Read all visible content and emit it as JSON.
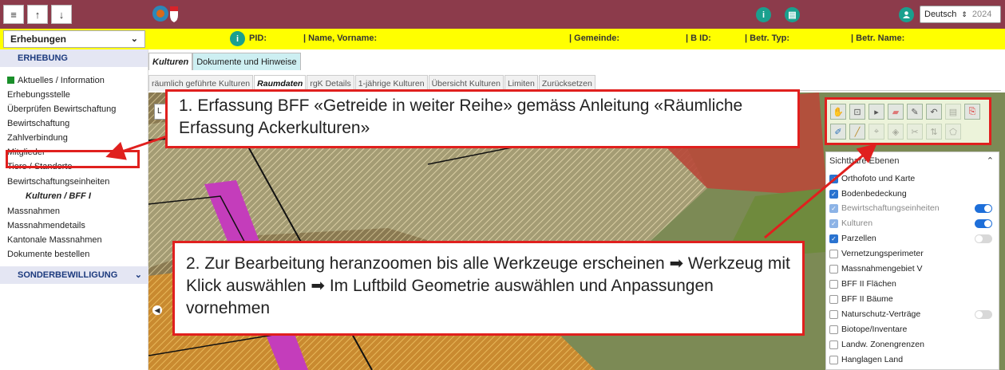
{
  "topbar": {
    "menu_icon": "hamburger-icon",
    "up_icon": "arrow-up-icon",
    "down_icon": "arrow-down-icon",
    "info_label": "i",
    "doc_label": "▤",
    "user_label": "●",
    "language": "Deutsch",
    "year": "2024"
  },
  "header": {
    "survey_select": "Erhebungen",
    "info_label": "i",
    "columns": [
      "PID:",
      "| Name, Vorname:",
      "| Gemeinde:",
      "| B ID:",
      "| Betr. Typ:",
      "| Betr. Name:"
    ]
  },
  "sidebar": {
    "section1": "ERHEBUNG",
    "items": [
      "Aktuelles / Information",
      "Erhebungsstelle",
      "Überprüfen Bewirtschaftung",
      "Bewirtschaftung",
      "Zahlverbindung",
      "Mitglieder",
      "Tiere / Standorte",
      "Bewirtschaftungseinheiten",
      "Kulturen / BFF I",
      "Massnahmen",
      "Massnahmendetails",
      "Kantonale Massnahmen",
      "Dokumente bestellen"
    ],
    "section2": "SONDERBEWILLIGUNG"
  },
  "tabs": {
    "primary": [
      "Kulturen",
      "Dokumente und Hinweise"
    ],
    "secondary": [
      "räumlich geführte Kulturen",
      "Raumdaten",
      "rgK Details",
      "1-jährige Kulturen",
      "Übersicht Kulturen",
      "Limiten",
      "Zurücksetzen"
    ]
  },
  "map": {
    "layer_panel_title": "Sichtbare Ebenen",
    "layers": [
      {
        "label": "Orthofoto und Karte",
        "checked": true
      },
      {
        "label": "Bodenbedeckung",
        "checked": true
      },
      {
        "label": "Bewirtschaftungseinheiten",
        "checked": true,
        "toggle": "on"
      },
      {
        "label": "Kulturen",
        "checked": true,
        "toggle": "on"
      },
      {
        "label": "Parzellen",
        "checked": true,
        "toggle": "off"
      },
      {
        "label": "Vernetzungsperimeter",
        "checked": false
      },
      {
        "label": "Massnahmengebiet V",
        "checked": false
      },
      {
        "label": "BFF II Flächen",
        "checked": false
      },
      {
        "label": "BFF II Bäume",
        "checked": false
      },
      {
        "label": "Naturschutz-Verträge",
        "checked": false,
        "toggle": "off"
      },
      {
        "label": "Biotope/Inventare",
        "checked": false
      },
      {
        "label": "Landw. Zonengrenzen",
        "checked": false
      },
      {
        "label": "Hanglagen Land",
        "checked": false
      }
    ],
    "tools_row1": [
      "hand-icon",
      "zoom-box-icon",
      "pointer-icon",
      "eraser-icon",
      "pencil-icon",
      "undo-icon",
      "document-icon",
      "pdf-icon"
    ],
    "tools_row2": [
      "edit-vertex-icon",
      "draw-line-icon",
      "split-icon",
      "merge-icon",
      "cut-icon",
      "measure-icon",
      "polygon-icon"
    ]
  },
  "callouts": {
    "callout1": "1. Erfassung BFF «Getreide in weiter Reihe» gemäss Anleitung «Räumliche Erfassung Ackerkulturen»",
    "callout2": "2. Zur Bearbeitung heranzoomen bis alle Werkzeuge erscheinen ➡ Werkzeug mit Klick auswählen ➡ Im Luftbild Geometrie auswählen und Anpassungen vornehmen"
  },
  "colors": {
    "topbar": "#8c3b4b",
    "header": "#ffff00",
    "accent": "#1aa08e",
    "highlight": "#e0201e"
  }
}
